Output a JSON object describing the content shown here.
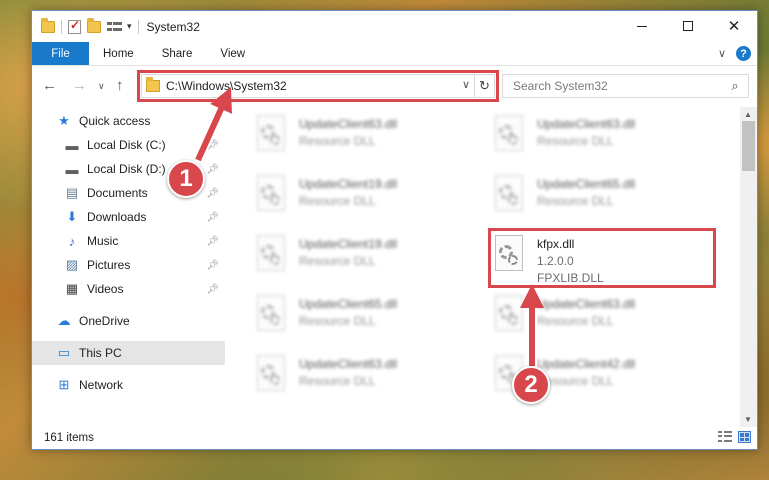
{
  "window": {
    "title": "System32"
  },
  "ribbon": {
    "tabs": [
      "File",
      "Home",
      "Share",
      "View"
    ],
    "help": "?"
  },
  "address": {
    "path": "C:\\Windows\\System32"
  },
  "search": {
    "placeholder": "Search System32"
  },
  "nav": {
    "items": [
      {
        "label": "Quick access",
        "icon": "star-icon"
      },
      {
        "label": "Local Disk (C:)",
        "icon": "drive-icon"
      },
      {
        "label": "Local Disk (D:)",
        "icon": "drive-icon"
      },
      {
        "label": "Documents",
        "icon": "documents-icon"
      },
      {
        "label": "Downloads",
        "icon": "downloads-icon"
      },
      {
        "label": "Music",
        "icon": "music-icon"
      },
      {
        "label": "Pictures",
        "icon": "pictures-icon"
      },
      {
        "label": "Videos",
        "icon": "videos-icon"
      },
      {
        "label": "OneDrive",
        "icon": "cloud-icon"
      },
      {
        "label": "This PC",
        "icon": "computer-icon"
      },
      {
        "label": "Network",
        "icon": "network-icon"
      }
    ]
  },
  "files": {
    "left": [
      {
        "name": "UpdateClient63.dll",
        "type": "Resource DLL"
      },
      {
        "name": "UpdateClient19.dll",
        "type": "Resource DLL"
      },
      {
        "name": "UpdateClient19.dll",
        "type": "Resource DLL"
      },
      {
        "name": "UpdateClient65.dll",
        "type": "Resource DLL"
      },
      {
        "name": "UpdateClient63.dll",
        "type": "Resource DLL"
      }
    ],
    "right": [
      {
        "name": "UpdateClient63.dll",
        "type": "Resource DLL"
      },
      {
        "name": "UpdateClient65.dll",
        "type": "Resource DLL"
      },
      {
        "name": "UpdateClient63.dll",
        "type": "Resource DLL"
      },
      {
        "name": "UpdateClient42.dll",
        "type": "Resource DLL"
      }
    ],
    "highlighted": {
      "name": "kfpx.dll",
      "version": "1.2.0.0",
      "description": "FPXLIB.DLL"
    }
  },
  "status": {
    "item_count": "161 items"
  },
  "annotations": {
    "step1": "1",
    "step2": "2",
    "color": "#d8474b"
  }
}
